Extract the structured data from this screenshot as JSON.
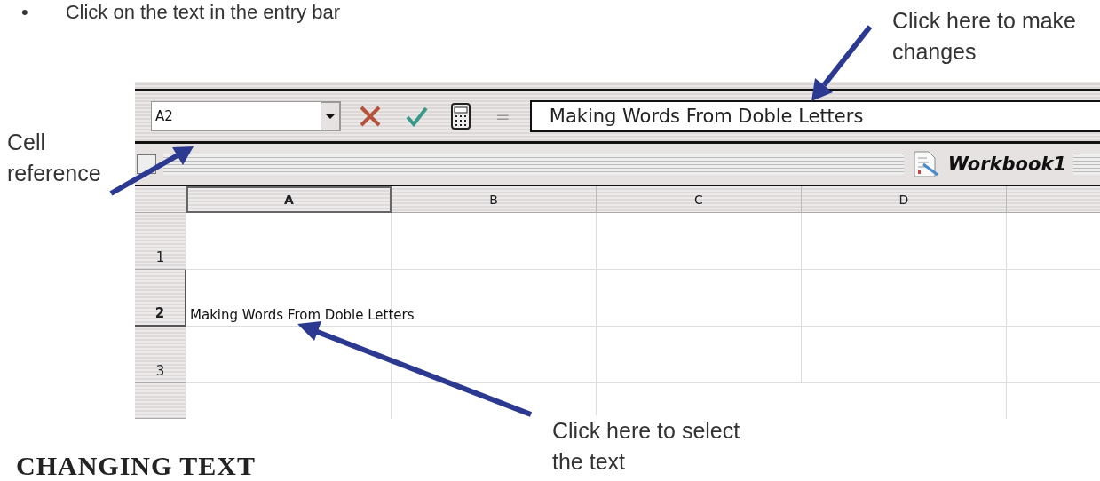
{
  "instruction": {
    "bullet": "•",
    "text": "Click on the text in the entry bar"
  },
  "callouts": [
    {
      "text": "Click here to make changes"
    },
    {
      "text": "Cell reference"
    },
    {
      "text": "Click here to select the text"
    }
  ],
  "formula_bar": {
    "name_box": "A2",
    "equals": "=",
    "entry": "Making Words From Doble Letters"
  },
  "workbook": {
    "title": "Workbook1"
  },
  "sheet": {
    "columns": [
      {
        "label": "A",
        "selected": true
      },
      {
        "label": "B",
        "selected": false
      },
      {
        "label": "C",
        "selected": false
      },
      {
        "label": "D",
        "selected": false
      }
    ],
    "rows": [
      {
        "label": "1",
        "selected": false,
        "cells": []
      },
      {
        "label": "2",
        "selected": true,
        "cells": [
          "Making Words From Doble Letters"
        ]
      },
      {
        "label": "3",
        "selected": false,
        "cells": []
      }
    ]
  },
  "heading": "CHANGING TEXT"
}
